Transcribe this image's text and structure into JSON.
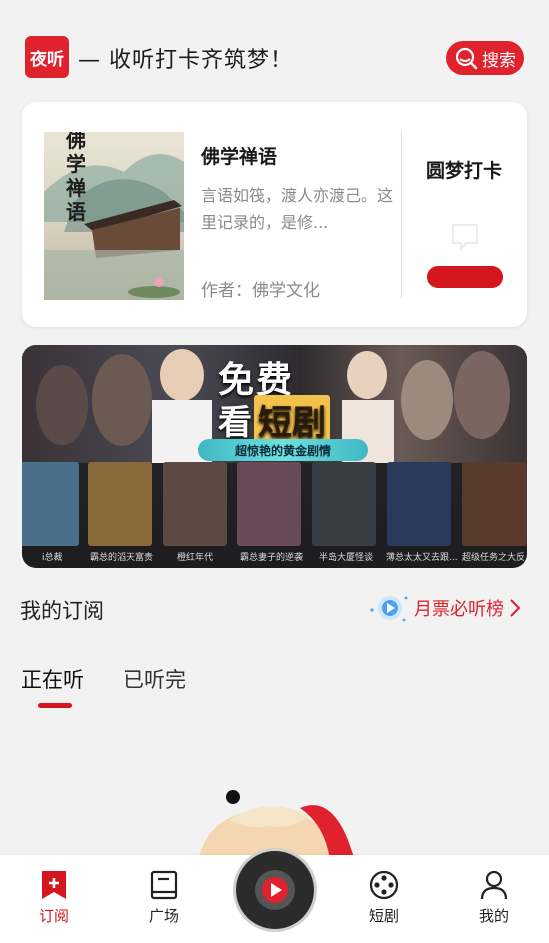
{
  "header": {
    "logo_text": "夜听",
    "slogan": "— 收听打卡齐筑梦！",
    "search_label": "搜索"
  },
  "book_card": {
    "cover_text": "佛学禅语",
    "title": "佛学禅语",
    "description": "言语如筏，渡人亦渡己。这里记录的，是修...",
    "author": "作者：佛学文化",
    "checkin_title": "圆梦打卡"
  },
  "banner": {
    "headline_1": "免费",
    "headline_2_prefix": "看",
    "headline_2_highlight": "短剧",
    "tagline": "超惊艳的黄金剧情",
    "posters": [
      {
        "label": "i总裁",
        "color": "#4a6f8a"
      },
      {
        "label": "霸总的滔天富贵",
        "color": "#8a6a3a"
      },
      {
        "label": "橙红年代",
        "color": "#5a4a42"
      },
      {
        "label": "霸总妻子的逆袭",
        "color": "#6a4a5a"
      },
      {
        "label": "半岛大厦怪谈",
        "color": "#3a3d44"
      },
      {
        "label": "薄总太太又去跟...",
        "color": "#2a3a5a"
      },
      {
        "label": "超级任务之大反",
        "color": "#5a3a2a"
      }
    ]
  },
  "subscriptions": {
    "title": "我的订阅",
    "ranking_label": "月票必听榜"
  },
  "tabs": [
    {
      "label": "正在听",
      "active": true
    },
    {
      "label": "已听完",
      "active": false
    }
  ],
  "bottom_nav": {
    "items": [
      {
        "label": "订阅",
        "icon": "bookmark-icon",
        "active": true
      },
      {
        "label": "广场",
        "icon": "book-icon",
        "active": false
      },
      {
        "label": "短剧",
        "icon": "film-reel-icon",
        "active": false
      },
      {
        "label": "我的",
        "icon": "user-icon",
        "active": false
      }
    ]
  },
  "colors": {
    "brand_red": "#e0222d",
    "background": "#f2f2f3"
  }
}
